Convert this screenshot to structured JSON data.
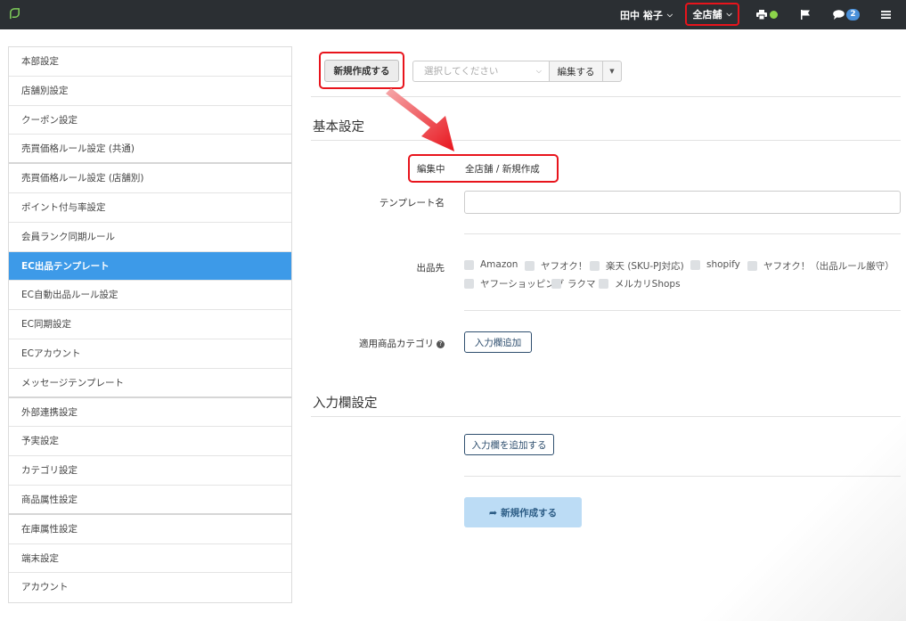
{
  "header": {
    "user_name": "田中 裕子",
    "store_selector": "全店舗",
    "notification_count": "2",
    "status_color": "#8cd44a"
  },
  "sidebar": {
    "items": [
      {
        "label": "本部設定"
      },
      {
        "label": "店舗別設定"
      },
      {
        "label": "クーポン設定"
      },
      {
        "label": "売買価格ルール設定 (共通)"
      },
      {
        "label": "売買価格ルール設定 (店舗別)"
      },
      {
        "label": "ポイント付与率設定"
      },
      {
        "label": "会員ランク同期ルール"
      },
      {
        "label": "EC出品テンプレート",
        "active": true
      },
      {
        "label": "EC自動出品ルール設定"
      },
      {
        "label": "EC同期設定"
      },
      {
        "label": "ECアカウント"
      },
      {
        "label": "メッセージテンプレート"
      },
      {
        "label": "外部連携設定"
      },
      {
        "label": "予実設定"
      },
      {
        "label": "カテゴリ設定"
      },
      {
        "label": "商品属性設定"
      },
      {
        "label": "在庫属性設定"
      },
      {
        "label": "端末設定"
      },
      {
        "label": "アカウント"
      }
    ]
  },
  "toolbar": {
    "new_button": "新規作成する",
    "select_placeholder": "選択してください",
    "edit_button": "編集する"
  },
  "basic_settings": {
    "title": "基本設定",
    "status_label": "編集中",
    "status_value": "全店舗 / 新規作成",
    "template_name_label": "テンプレート名",
    "template_name_value": "",
    "channels_label": "出品先",
    "channels": [
      "Amazon",
      "ヤフオク！",
      "楽天 (SKU-PJ対応)",
      "shopify",
      "ヤフオク！（出品ルール厳守）",
      "ヤフーショッピング",
      "ラクマ",
      "メルカリShops"
    ],
    "category_label": "適用商品カテゴリ",
    "add_field_button": "入力欄追加"
  },
  "input_settings": {
    "title": "入力欄設定",
    "add_field_button": "入力欄を追加する"
  },
  "submit_button": "新規作成する",
  "colors": {
    "accent": "#3d9ae8",
    "highlight": "#e8141c",
    "topbar": "#2b2f33"
  }
}
